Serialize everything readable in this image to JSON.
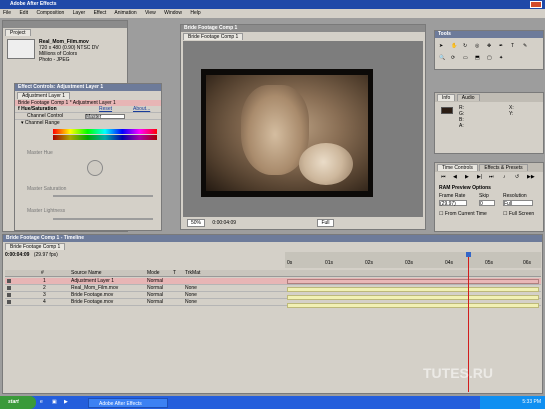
{
  "app": {
    "title": "Adobe After Effects"
  },
  "menu": [
    "File",
    "Edit",
    "Composition",
    "Layer",
    "Effect",
    "Animation",
    "View",
    "Window",
    "Help"
  ],
  "project": {
    "tab": "Project",
    "file_name": "Real_Mom_Film.mov",
    "info_lines": [
      "720 x 480 (0.90) NTSC DV",
      "Millions of Colors",
      "Photo - JPEG"
    ]
  },
  "effect_controls": {
    "title": "Effect Controls: Adjustment Layer 1",
    "tab": "Adjustment Layer 1",
    "breadcrumb": "Bride Footage Comp 1 * Adjustment Layer 1",
    "effect_name": "Hue/Saturation",
    "reset": "Reset",
    "about": "About...",
    "channel_control_label": "Channel Control",
    "channel_control_value": "Master",
    "channel_range_label": "Channel Range",
    "params": [
      "Master Hue",
      "Master Saturation",
      "Master Lightness"
    ]
  },
  "comp_viewer": {
    "window_title": "Bride Footage Comp 1",
    "tab": "Bride Footage Comp 1",
    "zoom": "50%",
    "timecode": "0:00:04:09",
    "resolution": "Full"
  },
  "tools": {
    "title": "Tools"
  },
  "info": {
    "tabs": [
      "Info",
      "Audio"
    ],
    "values": [
      "R:",
      "G:",
      "B:",
      "A:",
      "X:",
      "Y:"
    ]
  },
  "time_controls": {
    "title": "Time Controls",
    "tabs": [
      "Time Controls",
      "Effects & Presets"
    ],
    "ram_preview_label": "RAM Preview Options",
    "frame_rate_label": "Frame Rate",
    "frame_rate_value": "(29.97)",
    "skip_label": "Skip",
    "skip_value": "0",
    "resolution_label": "Resolution",
    "resolution_value": "Full",
    "from_current": "From Current Time",
    "full_screen": "Full Screen"
  },
  "timeline": {
    "title": "Bride Footage Comp 1 - Timeline",
    "tab": "Bride Footage Comp 1",
    "timecode": "0:00:04:09",
    "fps": "(29.97 fps)",
    "columns": [
      "#",
      "Source Name",
      "Mode",
      "T",
      "TrkMat"
    ],
    "ruler_ticks": [
      "0s",
      "01s",
      "02s",
      "03s",
      "04s",
      "05s",
      "06s"
    ],
    "layers": [
      {
        "num": "1",
        "name": "Adjustment Layer 1",
        "mode": "Normal",
        "trkmat": ""
      },
      {
        "num": "2",
        "name": "Real_Mom_Film.mov",
        "mode": "Normal",
        "trkmat": "None"
      },
      {
        "num": "3",
        "name": "Bride Footage.mov",
        "mode": "Normal",
        "trkmat": "None"
      },
      {
        "num": "4",
        "name": "Bride Footage.mov",
        "mode": "Normal",
        "trkmat": "None"
      }
    ],
    "playhead_fraction": 0.72
  },
  "taskbar": {
    "start": "start",
    "task": "Adobe After Effects",
    "clock": "5:33 PM"
  },
  "watermark": "TUTES.RU",
  "colors": {
    "title_active": "#1f49a8",
    "panel_bg": "#d4d0c8",
    "layer_bar": "#f1f0b4",
    "selected_layer": "#e7b5b5",
    "playhead": "#d11c1c"
  }
}
